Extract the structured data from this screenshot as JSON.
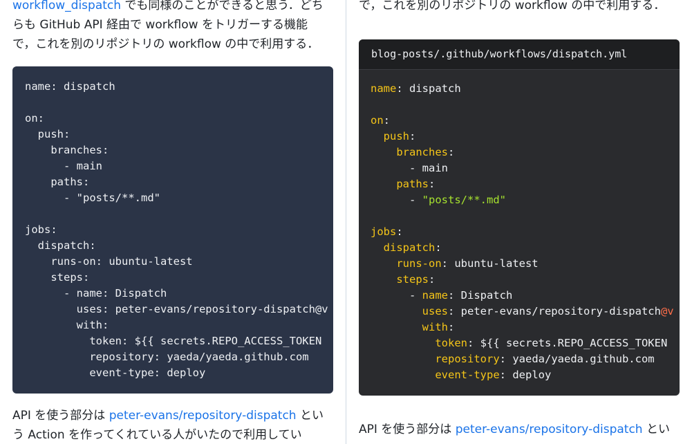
{
  "left": {
    "intro": {
      "link": "workflow_dispatch",
      "line1_rest": " でも同様のことができると思う．どち",
      "line2": "らも GitHub API 経由で workflow をトリガーする機能",
      "line3": "で，これを別のリポジトリの workflow の中で利用する．"
    },
    "outro": {
      "prefix": "API を使う部分は ",
      "link": "peter-evans/repository-dispatch",
      "suffix": " とい",
      "line2": "う Action を作ってくれている人がいたので利用してい"
    }
  },
  "right": {
    "intro_line": "で，これを別のリポジトリの workflow の中で利用する．",
    "code_title": "blog-posts/.github/workflows/dispatch.yml",
    "outro": {
      "prefix": "API を使う部分は ",
      "link": "peter-evans/repository-dispatch",
      "suffix": " とい"
    }
  },
  "code_lines": [
    {
      "indent": "",
      "key": "name",
      "sep": ": ",
      "value": "dispatch"
    },
    {
      "indent": "",
      "key": "",
      "sep": "",
      "value": ""
    },
    {
      "indent": "",
      "key": "on",
      "sep": ":",
      "value": ""
    },
    {
      "indent": "  ",
      "key": "push",
      "sep": ":",
      "value": ""
    },
    {
      "indent": "    ",
      "key": "branches",
      "sep": ":",
      "value": ""
    },
    {
      "indent": "      ",
      "key": "",
      "sep": "- ",
      "value": "main"
    },
    {
      "indent": "    ",
      "key": "paths",
      "sep": ":",
      "value": ""
    },
    {
      "indent": "      ",
      "key": "",
      "sep": "- ",
      "value": "\"posts/**.md\"",
      "string": true
    },
    {
      "indent": "",
      "key": "",
      "sep": "",
      "value": ""
    },
    {
      "indent": "",
      "key": "jobs",
      "sep": ":",
      "value": ""
    },
    {
      "indent": "  ",
      "key": "dispatch",
      "sep": ":",
      "value": ""
    },
    {
      "indent": "    ",
      "key": "runs-on",
      "sep": ": ",
      "value": "ubuntu-latest"
    },
    {
      "indent": "    ",
      "key": "steps",
      "sep": ":",
      "value": ""
    },
    {
      "indent": "      ",
      "dash": "- ",
      "key": "name",
      "sep": ": ",
      "value": "Dispatch"
    },
    {
      "indent": "        ",
      "key": "uses",
      "sep": ": ",
      "value": "peter-evans/repository-dispatch",
      "at": "@v"
    },
    {
      "indent": "        ",
      "key": "with",
      "sep": ":",
      "value": ""
    },
    {
      "indent": "          ",
      "key": "token",
      "sep": ": ",
      "value": "${{ secrets.REPO_ACCESS_TOKEN"
    },
    {
      "indent": "          ",
      "key": "repository",
      "sep": ": ",
      "value": "yaeda/yaeda.github.com"
    },
    {
      "indent": "          ",
      "key": "event-type",
      "sep": ": ",
      "value": "deploy"
    }
  ],
  "colors": {
    "link": "#1a73e8",
    "left_code_bg": "#2b3447",
    "right_code_bg": "#2a2b2e",
    "right_title_bg": "#1e1f21",
    "yaml_key": "#f5c518",
    "yaml_string": "#a6e22e",
    "yaml_at": "#ff6e4a"
  }
}
